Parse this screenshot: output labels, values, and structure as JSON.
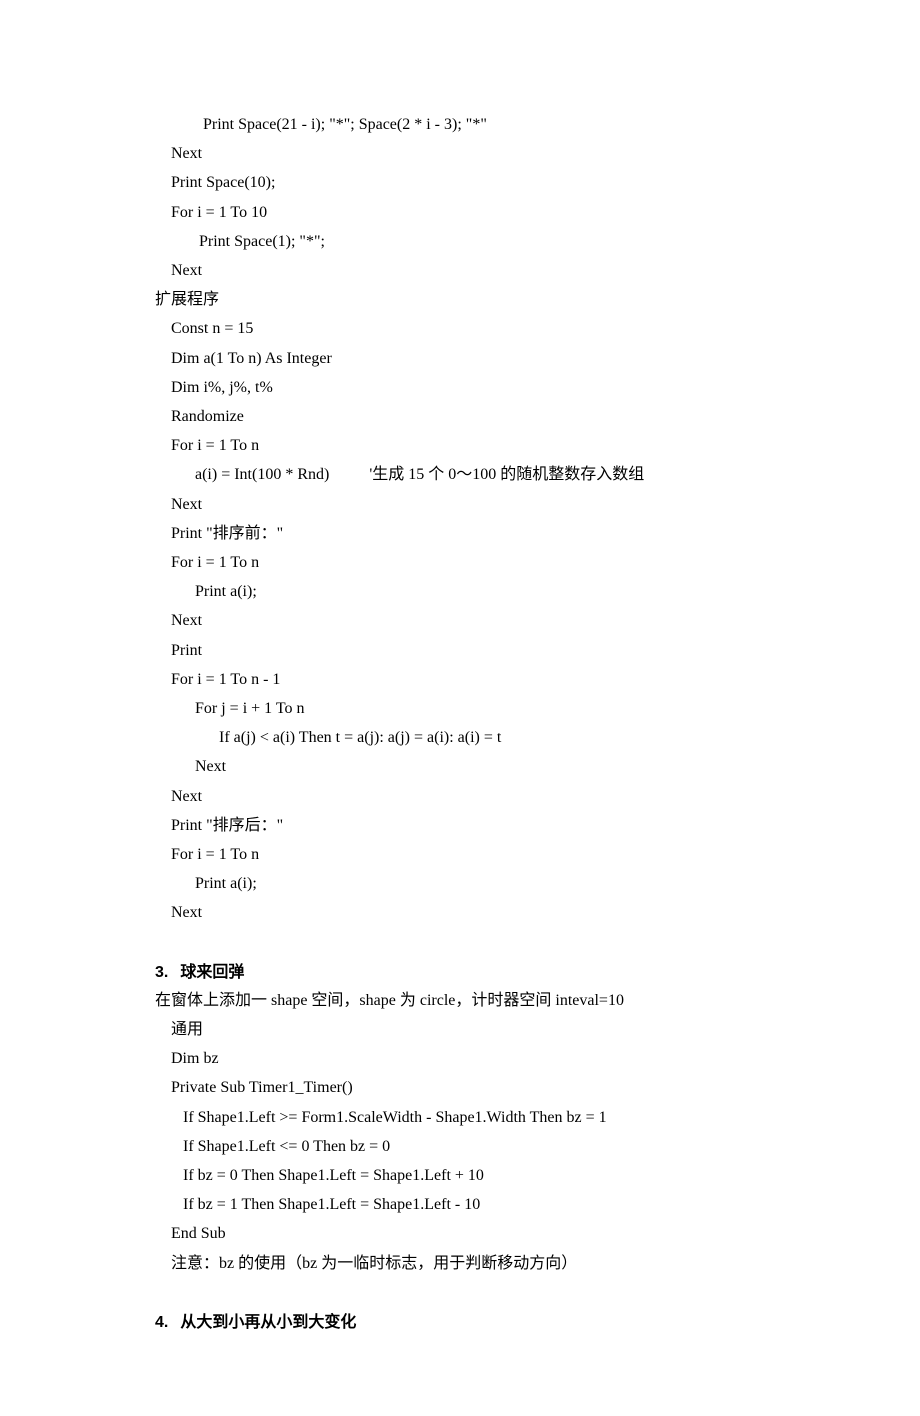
{
  "block1": [
    "            Print Space(21 - i); \"*\"; Space(2 * i - 3); \"*\"",
    "    Next",
    "    Print Space(10);",
    "    For i = 1 To 10",
    "           Print Space(1); \"*\";",
    "    Next"
  ],
  "extLabel": "扩展程序",
  "block2": [
    "    Const n = 15",
    "    Dim a(1 To n) As Integer",
    "    Dim i%, j%, t%",
    "    Randomize",
    "    For i = 1 To n",
    "          a(i) = Int(100 * Rnd)          '生成 15 个 0～100 的随机整数存入数组",
    "    Next",
    "    Print \"排序前：\"",
    "    For i = 1 To n",
    "          Print a(i);",
    "    Next",
    "    Print",
    "    For i = 1 To n - 1",
    "          For j = i + 1 To n",
    "                If a(j) < a(i) Then t = a(j): a(j) = a(i): a(i) = t",
    "          Next",
    "    Next",
    "    Print \"排序后：\"",
    "    For i = 1 To n",
    "          Print a(i);",
    "    Next"
  ],
  "heading3": {
    "num": "3.",
    "title": "球来回弹"
  },
  "desc3": "在窗体上添加一 shape 空间，shape 为 circle，计时器空间 inteval=10",
  "block3": [
    "    通用",
    "    Dim bz",
    "",
    "    Private Sub Timer1_Timer()",
    "       If Shape1.Left >= Form1.ScaleWidth - Shape1.Width Then bz = 1",
    "       If Shape1.Left <= 0 Then bz = 0",
    "       If bz = 0 Then Shape1.Left = Shape1.Left + 10",
    "       If bz = 1 Then Shape1.Left = Shape1.Left - 10",
    "    End Sub"
  ],
  "note3": "    注意：bz 的使用（bz 为一临时标志，用于判断移动方向）",
  "heading4": {
    "num": "4.",
    "title": "从大到小再从小到大变化"
  }
}
